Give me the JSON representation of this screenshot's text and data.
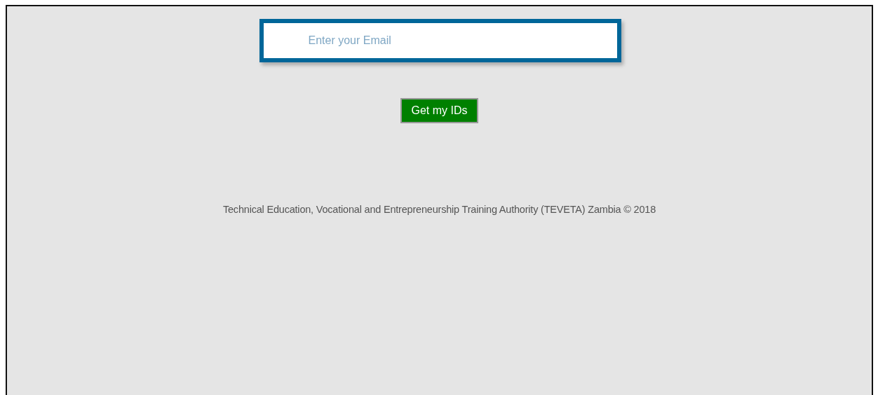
{
  "email_field": {
    "placeholder": "Enter your Email"
  },
  "submit_button": {
    "label": "Get my IDs"
  },
  "footer": {
    "text": "Technical Education, Vocational and Entrepreneurship Training Authority (TEVETA) Zambia © 2018"
  }
}
